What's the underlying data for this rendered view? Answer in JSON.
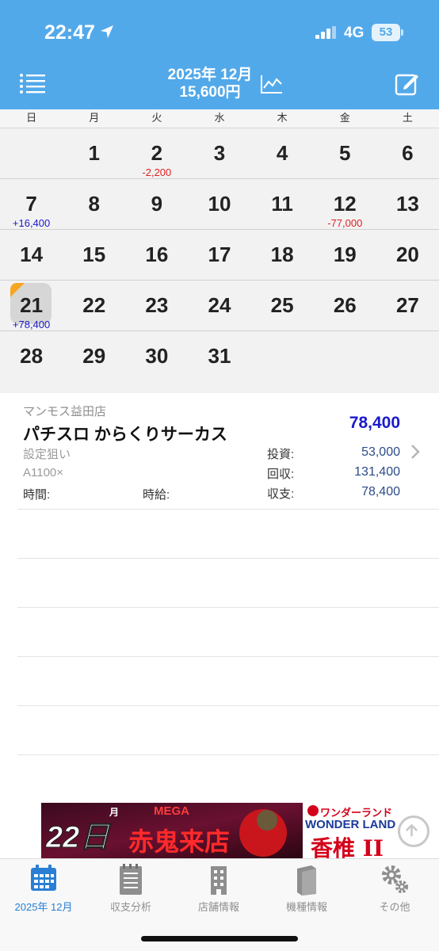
{
  "status_bar": {
    "time": "22:47",
    "network": "4G",
    "battery": "53"
  },
  "header": {
    "month": "2025年 12月",
    "total": "15,600円"
  },
  "calendar": {
    "weekdays": [
      "日",
      "月",
      "火",
      "水",
      "木",
      "金",
      "土"
    ],
    "weeks": [
      [
        {
          "day": "",
          "amount": ""
        },
        {
          "day": "1",
          "amount": ""
        },
        {
          "day": "2",
          "amount": "-2,200"
        },
        {
          "day": "3",
          "amount": ""
        },
        {
          "day": "4",
          "amount": ""
        },
        {
          "day": "5",
          "amount": ""
        },
        {
          "day": "6",
          "amount": ""
        }
      ],
      [
        {
          "day": "7",
          "amount": "+16,400"
        },
        {
          "day": "8",
          "amount": ""
        },
        {
          "day": "9",
          "amount": ""
        },
        {
          "day": "10",
          "amount": ""
        },
        {
          "day": "11",
          "amount": ""
        },
        {
          "day": "12",
          "amount": "-77,000"
        },
        {
          "day": "13",
          "amount": ""
        }
      ],
      [
        {
          "day": "14",
          "amount": ""
        },
        {
          "day": "15",
          "amount": ""
        },
        {
          "day": "16",
          "amount": ""
        },
        {
          "day": "17",
          "amount": ""
        },
        {
          "day": "18",
          "amount": ""
        },
        {
          "day": "19",
          "amount": ""
        },
        {
          "day": "20",
          "amount": ""
        }
      ],
      [
        {
          "day": "21",
          "amount": "+78,400",
          "selected": true
        },
        {
          "day": "22",
          "amount": ""
        },
        {
          "day": "23",
          "amount": ""
        },
        {
          "day": "24",
          "amount": ""
        },
        {
          "day": "25",
          "amount": ""
        },
        {
          "day": "26",
          "amount": ""
        },
        {
          "day": "27",
          "amount": ""
        }
      ],
      [
        {
          "day": "28",
          "amount": ""
        },
        {
          "day": "29",
          "amount": ""
        },
        {
          "day": "30",
          "amount": ""
        },
        {
          "day": "31",
          "amount": ""
        },
        {
          "day": "",
          "amount": ""
        },
        {
          "day": "",
          "amount": ""
        },
        {
          "day": "",
          "amount": ""
        }
      ]
    ]
  },
  "entry": {
    "shop": "マンモス益田店",
    "machine": "パチスロ からくりサーカス",
    "total": "78,400",
    "strategy": "設定狙い",
    "rate": "A1100×",
    "time_label": "時間:",
    "hourly_label": "時給:",
    "invest_label": "投資:",
    "invest_value": "53,000",
    "recover_label": "回収:",
    "recover_value": "131,400",
    "balance_label": "収支:",
    "balance_value": "78,400"
  },
  "ad": {
    "date": "22日",
    "day_of_week": "月",
    "mega": "MEGA",
    "event": "赤鬼来店",
    "store_ja": "ワンダーランド",
    "store_en": "WONDER LAND",
    "branch": "香椎 II"
  },
  "tabs": [
    {
      "label": "2025年 12月",
      "icon": "calendar-icon",
      "active": true
    },
    {
      "label": "収支分析",
      "icon": "notepad-icon"
    },
    {
      "label": "店舗情報",
      "icon": "building-icon"
    },
    {
      "label": "機種情報",
      "icon": "book-icon"
    },
    {
      "label": "その他",
      "icon": "gear-icon"
    }
  ],
  "colors": {
    "accent": "#52a9ea",
    "positive": "#1a1acc",
    "negative": "#e02020",
    "tab_active": "#2a7fd4",
    "selected_marker": "#f5a623"
  }
}
